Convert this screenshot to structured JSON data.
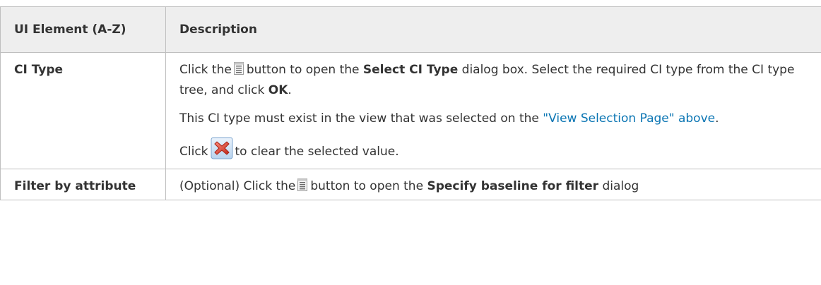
{
  "table": {
    "headers": {
      "element": "UI Element (A-Z)",
      "description": "Description"
    },
    "rows": [
      {
        "element": "CI Type",
        "p1": {
          "pre": "Click the",
          "mid": "button to open the",
          "bold": "Select CI Type",
          "post1": "dialog box. Select the required CI type from the CI type tree, and click",
          "ok": "OK",
          "end": "."
        },
        "p2": {
          "pre": "This CI type must exist in the view that was selected on the",
          "link": "\"View Selection Page\" above",
          "end": "."
        },
        "p3": {
          "pre": "Click",
          "post": "to clear the selected value."
        }
      },
      {
        "element": "Filter by attribute",
        "p1": {
          "pre": "(Optional) Click the",
          "mid": "button to open the",
          "bold": "Specify baseline for filter",
          "post": "dialog"
        }
      }
    ]
  },
  "icons": {
    "list_button": "list-document-icon",
    "clear_button": "red-x-clear-icon"
  },
  "colors": {
    "header_bg": "#eeeeee",
    "border": "#bfbfbf",
    "link": "#0a75b3",
    "text": "#333333"
  }
}
